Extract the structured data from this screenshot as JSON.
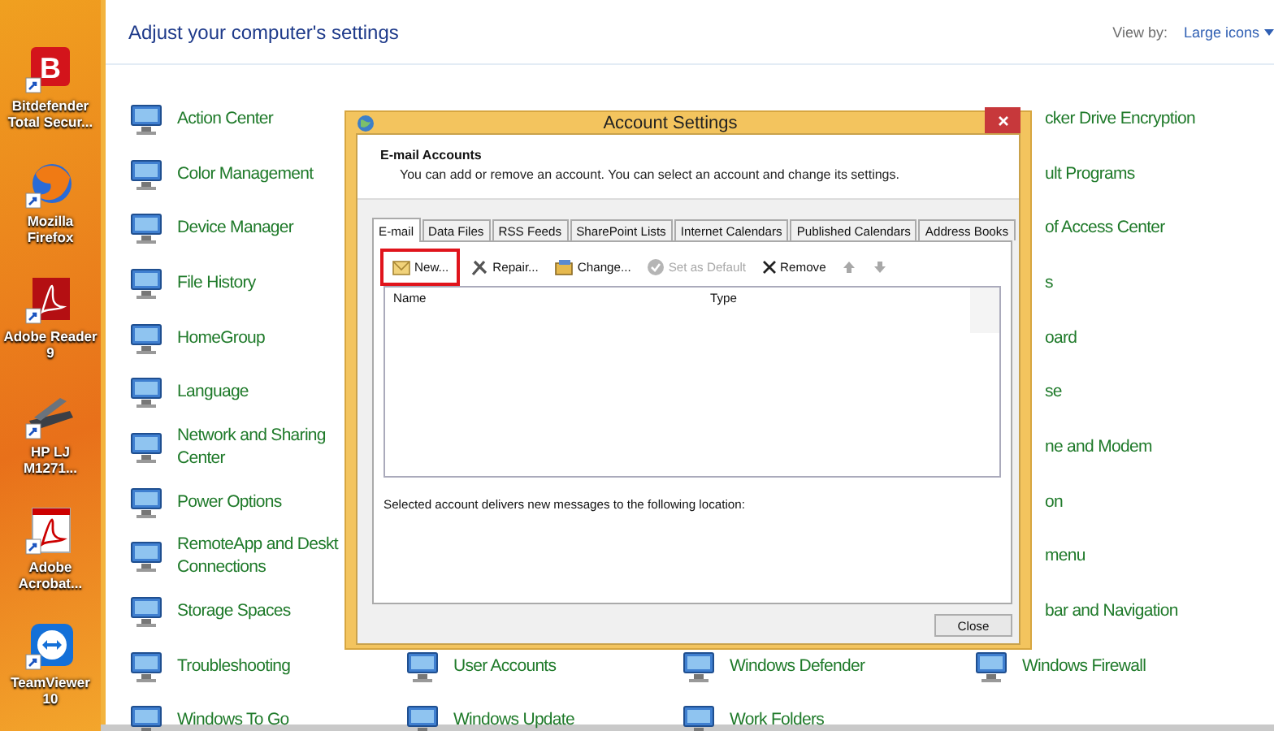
{
  "desktop": {
    "icons": [
      {
        "kind": "bitdefender",
        "label": "Bitdefender Total Secur...",
        "letter": "B"
      },
      {
        "kind": "browser",
        "label": "Mozilla Firefox"
      },
      {
        "kind": "pdf",
        "label": "Adobe Reader 9"
      },
      {
        "kind": "scanner",
        "label": "HP LJ M1271..."
      },
      {
        "kind": "pdf-page",
        "label": "Adobe Acrobat..."
      },
      {
        "kind": "remote",
        "label": "TeamViewer 10"
      }
    ]
  },
  "control_panel": {
    "heading": "Adjust your computer's settings",
    "view_by": {
      "label": "View by:",
      "value": "Large icons"
    },
    "columns": [
      {
        "items": [
          {
            "kind": "full",
            "text": "Action Center"
          },
          {
            "kind": "full",
            "text": "Color Management"
          },
          {
            "kind": "full",
            "text": "Device Manager"
          },
          {
            "kind": "full",
            "text": "File History"
          },
          {
            "kind": "full",
            "text": "HomeGroup"
          },
          {
            "kind": "full",
            "text": "Language"
          },
          {
            "kind": "full",
            "text": "Network and Sharing\nCenter"
          },
          {
            "kind": "full",
            "text": "Power Options"
          },
          {
            "kind": "full",
            "text": "RemoteApp and Deskt\nConnections"
          },
          {
            "kind": "full",
            "text": "Storage Spaces"
          },
          {
            "kind": "full",
            "text": "Troubleshooting"
          },
          {
            "kind": "full",
            "text": "Windows To Go"
          }
        ]
      },
      {
        "items": [
          {
            "kind": "full",
            "text": "User Accounts"
          },
          {
            "kind": "full",
            "text": "Windows Update"
          }
        ]
      },
      {
        "items": [
          {
            "kind": "full",
            "text": "Windows Defender"
          },
          {
            "kind": "full",
            "text": "Work Folders"
          }
        ]
      },
      {
        "items": [
          {
            "kind": "cut",
            "text": "cker Drive Encryption"
          },
          {
            "kind": "cut",
            "text": "ult Programs"
          },
          {
            "kind": "cut",
            "text": "of Access Center"
          },
          {
            "kind": "cut",
            "text": "s"
          },
          {
            "kind": "cut",
            "text": "oard"
          },
          {
            "kind": "cut",
            "text": "se"
          },
          {
            "kind": "cut",
            "text": "ne and Modem"
          },
          {
            "kind": "cut",
            "text": "on"
          },
          {
            "kind": "cut",
            "text": "menu"
          },
          {
            "kind": "cut",
            "text": "bar and Navigation"
          },
          {
            "kind": "full",
            "text": "Windows Firewall"
          }
        ]
      }
    ]
  },
  "dialog": {
    "title": "Account Settings",
    "section_title": "E-mail Accounts",
    "description": "You can add or remove an account. You can select an account and change its settings.",
    "tabs": [
      {
        "label": "E-mail",
        "selected": true
      },
      {
        "label": "Data Files",
        "selected": false
      },
      {
        "label": "RSS Feeds",
        "selected": false
      },
      {
        "label": "SharePoint Lists",
        "selected": false
      },
      {
        "label": "Internet Calendars",
        "selected": false
      },
      {
        "label": "Published Calendars",
        "selected": false
      },
      {
        "label": "Address Books",
        "selected": false
      }
    ],
    "toolbar": [
      {
        "kind": "new",
        "label": "New...",
        "disabled": false,
        "highlighted": true
      },
      {
        "kind": "repair",
        "label": "Repair...",
        "disabled": false,
        "highlighted": false
      },
      {
        "kind": "change",
        "label": "Change...",
        "disabled": false,
        "highlighted": false
      },
      {
        "kind": "default",
        "label": "Set as Default",
        "disabled": true,
        "highlighted": false
      },
      {
        "kind": "remove",
        "label": "Remove",
        "disabled": false,
        "highlighted": false
      },
      {
        "kind": "up",
        "disabled": true,
        "highlighted": false
      },
      {
        "kind": "down",
        "disabled": true,
        "highlighted": false
      }
    ],
    "table": {
      "columns": [
        "Name",
        "Type"
      ]
    },
    "location_text": "Selected account delivers new messages to the following location:",
    "buttons": [
      "Close"
    ]
  }
}
